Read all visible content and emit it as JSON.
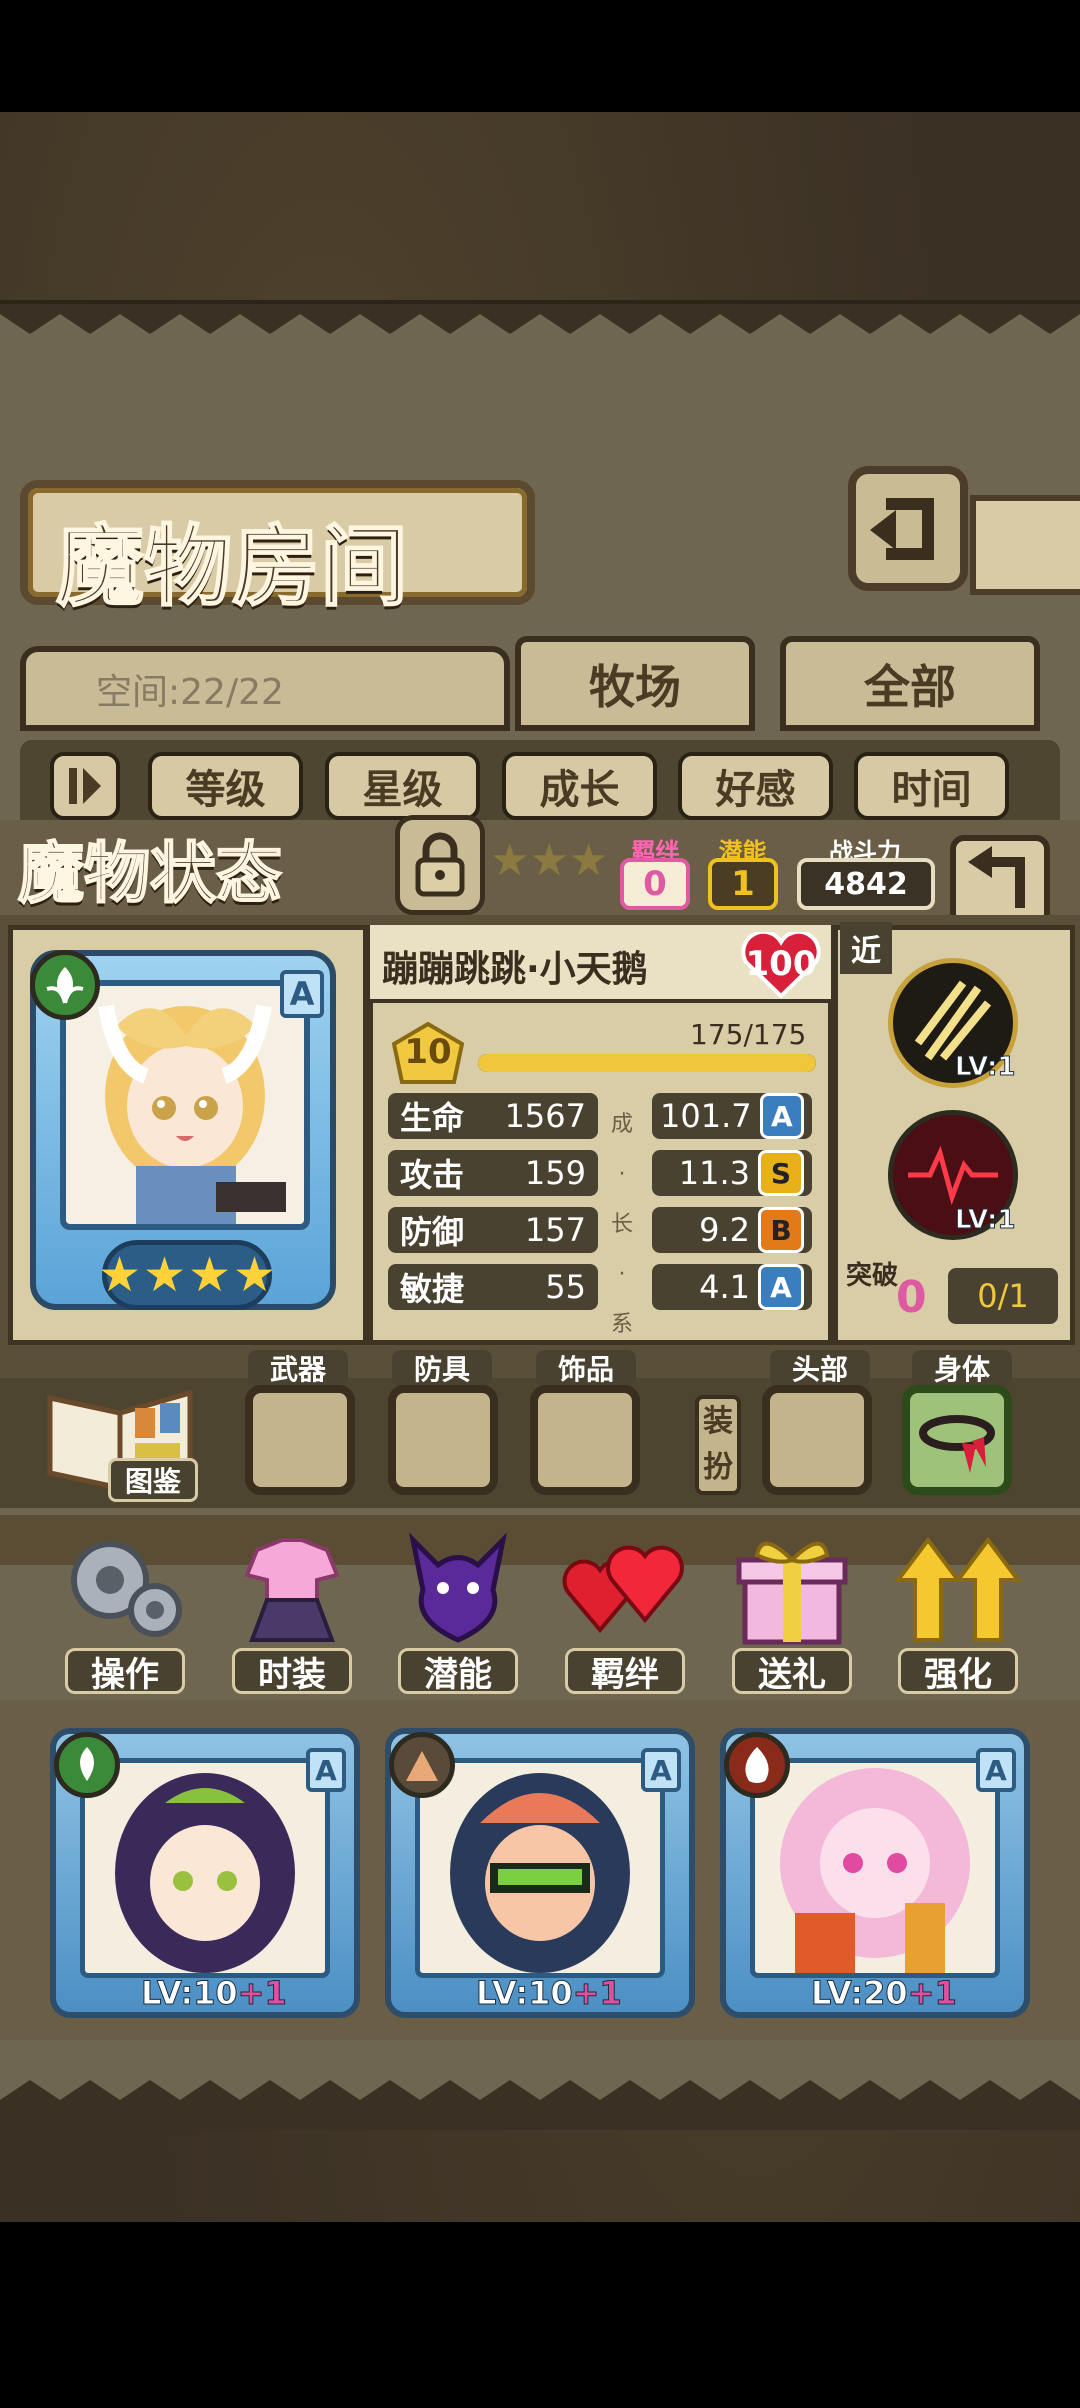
{
  "header": {
    "title": "魔物房间",
    "back_icon": "return-arrow-icon"
  },
  "tabs": {
    "space": "空间:22/22",
    "items": [
      {
        "label": "牧场"
      },
      {
        "label": "全部"
      }
    ]
  },
  "sort_buttons": [
    {
      "label": "等级"
    },
    {
      "label": "星级"
    },
    {
      "label": "成长"
    },
    {
      "label": "好感"
    },
    {
      "label": "时间"
    }
  ],
  "status": {
    "title": "魔物状态",
    "lock_icon": "padlock-icon",
    "bond": {
      "label": "羁绊",
      "value": "0"
    },
    "potential": {
      "label": "潜能",
      "value": "1"
    },
    "power": {
      "label": "战斗力",
      "value": "4842"
    },
    "monster": {
      "name": "蹦蹦跳跳·小天鹅",
      "affection": "100",
      "rank": "A",
      "element": "leaf",
      "stars": 4,
      "level": "10",
      "exp": "175/175",
      "exp_fraction": 1.0
    },
    "growth_label": "成·长·系·数",
    "stats": [
      {
        "label": "生命",
        "value": "1567",
        "growth": "101.7",
        "grade": "A"
      },
      {
        "label": "攻击",
        "value": "159",
        "growth": "11.3",
        "grade": "S"
      },
      {
        "label": "防御",
        "value": "157",
        "growth": "9.2",
        "grade": "B"
      },
      {
        "label": "敏捷",
        "value": "55",
        "growth": "4.1",
        "grade": "A"
      }
    ],
    "skills": {
      "type": "近",
      "items": [
        {
          "level": "LV:1",
          "icon": "claw-skill-icon"
        },
        {
          "level": "LV:1",
          "icon": "heartbeat-skill-icon"
        }
      ]
    },
    "breakthrough": {
      "label": "突破",
      "value": "0",
      "progress": "0/1"
    }
  },
  "equipment": {
    "codex": "图鉴",
    "dress_up": "装扮",
    "slots": [
      {
        "label": "武器"
      },
      {
        "label": "防具"
      },
      {
        "label": "饰品"
      },
      {
        "label": "头部"
      },
      {
        "label": "身体"
      }
    ]
  },
  "menu": [
    {
      "label": "操作",
      "icon": "gear-icon"
    },
    {
      "label": "时装",
      "icon": "outfit-icon"
    },
    {
      "label": "潜能",
      "icon": "shadow-demon-icon"
    },
    {
      "label": "羁绊",
      "icon": "hearts-icon"
    },
    {
      "label": "送礼",
      "icon": "gift-box-icon"
    },
    {
      "label": "强化",
      "icon": "up-arrows-icon"
    }
  ],
  "roster": [
    {
      "level": "LV:10",
      "plus": "+1",
      "rank": "A",
      "element": "leaf"
    },
    {
      "level": "LV:10",
      "plus": "+1",
      "rank": "A",
      "element": "earth"
    },
    {
      "level": "LV:20",
      "plus": "+1",
      "rank": "A",
      "element": "fire"
    }
  ]
}
